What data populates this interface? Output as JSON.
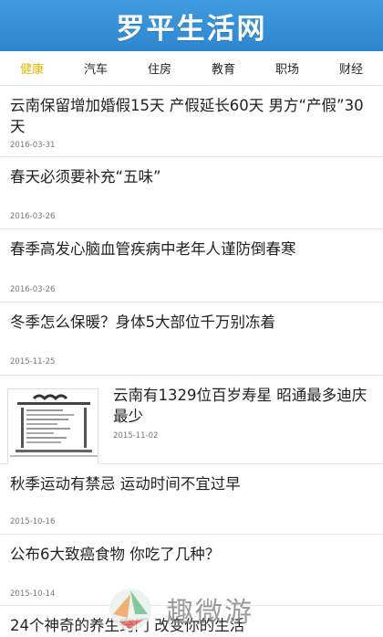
{
  "header": {
    "title": "罗平生活网"
  },
  "tabs": [
    {
      "label": "健康",
      "active": true
    },
    {
      "label": "汽车",
      "active": false
    },
    {
      "label": "住房",
      "active": false
    },
    {
      "label": "教育",
      "active": false
    },
    {
      "label": "职场",
      "active": false
    },
    {
      "label": "财经",
      "active": false
    }
  ],
  "articles": [
    {
      "headline": "云南保留增加婚假15天 产假延长60天 男方“产假”30天",
      "date": "2016-03-31"
    },
    {
      "headline": "春天必须要补充“五味”",
      "date": "2016-03-26"
    },
    {
      "headline": "春季高发心脑血管疾病中老年人谨防倒春寒",
      "date": "2016-03-26"
    },
    {
      "headline": "冬季怎么保暖？身体5大部位千万别冻着",
      "date": "2015-11-25"
    },
    {
      "headline": "云南有1329位百岁寿星 昭通最多迪庆最少",
      "date": "2015-11-02",
      "thumb_icon": "table-image-icon"
    },
    {
      "headline": "秋季运动有禁忌 运动时间不宜过早",
      "date": "2015-10-16"
    },
    {
      "headline": "公布6大致癌食物 你吃了几种？",
      "date": "2015-10-14"
    },
    {
      "headline": "24个神奇的养生窍门 改变你的生活",
      "date": ""
    }
  ],
  "watermark": {
    "text": "趣微游"
  },
  "colors": {
    "header_bg": "#2f86cf",
    "active_tab": "#e0b800"
  }
}
